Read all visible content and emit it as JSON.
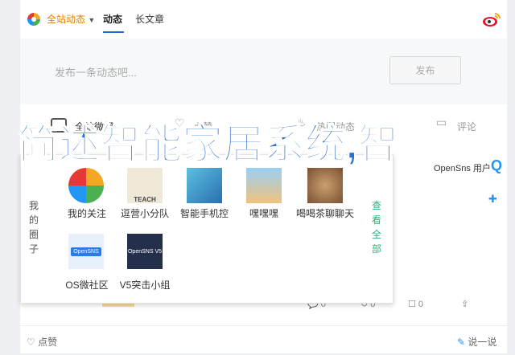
{
  "topbar": {
    "scope_label": "全站动态",
    "tab_feed": "动态",
    "tab_article": "长文章"
  },
  "composer": {
    "placeholder": "发布一条动态吧...",
    "post_label": "发布"
  },
  "filters": {
    "all": "全站微博",
    "like": "点赞",
    "hot": "热门动态",
    "comment": "评论"
  },
  "card": {
    "user_name": "OpenSns 用户",
    "actions": {
      "comment": "0",
      "share": "0",
      "repost": "0"
    }
  },
  "bottombar": {
    "like": "点赞",
    "say": "说一说"
  },
  "dropdown": {
    "left_label": "我的圈子",
    "right_label": "查看全部",
    "items": [
      {
        "label": "我的关注"
      },
      {
        "label": "逗营小分队"
      },
      {
        "label": "智能手机控"
      },
      {
        "label": "嘿嘿嘿"
      },
      {
        "label": "喝喝茶聊聊天"
      },
      {
        "label": "OS微社区"
      },
      {
        "label": "V5突击小组"
      }
    ],
    "thumb_texts": {
      "teach": "TEACH",
      "opensns": "OpenSNS",
      "v5_title": "OpenSNS V5"
    }
  },
  "overlay": {
    "title": "简述智能家居系统,智"
  },
  "colors": {
    "accent": "#1f6bd1",
    "overlay_text": "#2f6fd3",
    "green": "#2bb27a"
  }
}
